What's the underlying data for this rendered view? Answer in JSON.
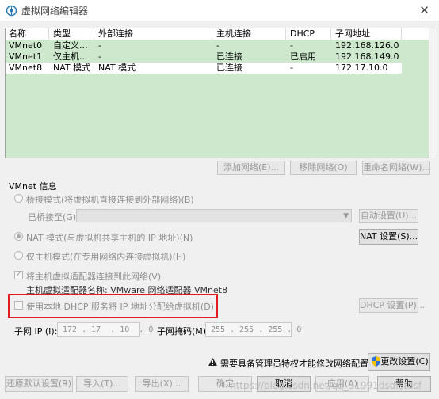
{
  "window": {
    "title": "虚拟网络编辑器",
    "close_glyph": "✕"
  },
  "table": {
    "headers": [
      "名称",
      "类型",
      "外部连接",
      "主机连接",
      "DHCP",
      "子网地址"
    ],
    "rows": [
      [
        "VMnet0",
        "自定义...",
        "-",
        "-",
        "-",
        "192.168.126.0"
      ],
      [
        "VMnet1",
        "仅主机...",
        "-",
        "已连接",
        "已启用",
        "192.168.149.0"
      ],
      [
        "VMnet8",
        "NAT 模式",
        "NAT 模式",
        "已连接",
        "-",
        "172.17.10.0"
      ]
    ]
  },
  "table_buttons": {
    "add": "添加网络(E)...",
    "remove": "移除网络(O)",
    "rename": "重命名网络(W)..."
  },
  "vmnet_info": {
    "group_label": "VMnet 信息",
    "bridged_label": "桥接模式(将虚拟机直接连接到外部网络)(B)",
    "bridged_to_label": "已桥接至(G):",
    "auto_button": "自动设置(U)...",
    "nat_label": "NAT 模式(与虚拟机共享主机的 IP 地址)(N)",
    "nat_button": "NAT 设置(S)...",
    "hostonly_label": "仅主机模式(在专用网络内连接虚拟机)(H)",
    "connect_adapter_label": "将主机虚拟适配器连接到此网络(V)",
    "adapter_name_label": "主机虚拟适配器名称: VMware 网络适配器 VMnet8",
    "dhcp_label": "使用本地 DHCP 服务将 IP 地址分配给虚拟机(D)",
    "dhcp_button": "DHCP 设置(P)...",
    "subnet_ip_label": "子网 IP (I):",
    "subnet_ip_value": "172 . 17  . 10  . 0",
    "subnet_mask_label": "子网掩码(M):",
    "subnet_mask_value": "255 . 255 . 255 . 0",
    "selected_mode": "nat",
    "connect_adapter_checked": true,
    "dhcp_checked": false
  },
  "admin": {
    "notice": "需要具备管理员特权才能修改网络配置。",
    "change_button": "更改设置(C)",
    "warning_icon": "warning-icon",
    "shield_icon": "shield-icon"
  },
  "footer": {
    "restore": "还原默认设置(R)",
    "import": "导入(T)...",
    "export": "导出(X)...",
    "ok": "确定",
    "cancel": "取消",
    "apply": "应用(A)",
    "help": "帮助"
  },
  "watermark": "https://blog.csdn.net/qq_31991dsdfsfdsf",
  "colors": {
    "table_bg": "#cde8cd",
    "highlight_border": "#e21c1c",
    "window_bg": "#f0f0f0"
  }
}
